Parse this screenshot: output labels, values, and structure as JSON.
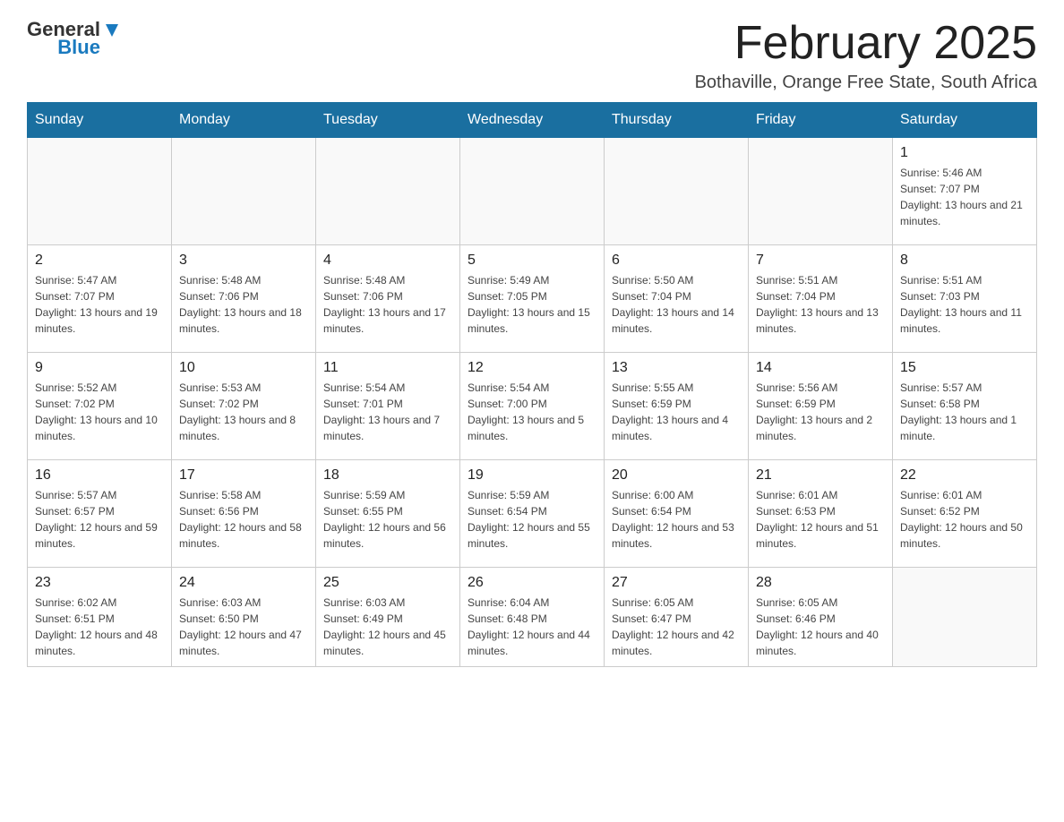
{
  "header": {
    "logo": {
      "general": "General",
      "blue": "Blue"
    },
    "month": "February 2025",
    "location": "Bothaville, Orange Free State, South Africa"
  },
  "days_of_week": [
    "Sunday",
    "Monday",
    "Tuesday",
    "Wednesday",
    "Thursday",
    "Friday",
    "Saturday"
  ],
  "weeks": [
    [
      {
        "day": "",
        "sunrise": "",
        "sunset": "",
        "daylight": "",
        "empty": true
      },
      {
        "day": "",
        "sunrise": "",
        "sunset": "",
        "daylight": "",
        "empty": true
      },
      {
        "day": "",
        "sunrise": "",
        "sunset": "",
        "daylight": "",
        "empty": true
      },
      {
        "day": "",
        "sunrise": "",
        "sunset": "",
        "daylight": "",
        "empty": true
      },
      {
        "day": "",
        "sunrise": "",
        "sunset": "",
        "daylight": "",
        "empty": true
      },
      {
        "day": "",
        "sunrise": "",
        "sunset": "",
        "daylight": "",
        "empty": true
      },
      {
        "day": "1",
        "sunrise": "Sunrise: 5:46 AM",
        "sunset": "Sunset: 7:07 PM",
        "daylight": "Daylight: 13 hours and 21 minutes.",
        "empty": false
      }
    ],
    [
      {
        "day": "2",
        "sunrise": "Sunrise: 5:47 AM",
        "sunset": "Sunset: 7:07 PM",
        "daylight": "Daylight: 13 hours and 19 minutes.",
        "empty": false
      },
      {
        "day": "3",
        "sunrise": "Sunrise: 5:48 AM",
        "sunset": "Sunset: 7:06 PM",
        "daylight": "Daylight: 13 hours and 18 minutes.",
        "empty": false
      },
      {
        "day": "4",
        "sunrise": "Sunrise: 5:48 AM",
        "sunset": "Sunset: 7:06 PM",
        "daylight": "Daylight: 13 hours and 17 minutes.",
        "empty": false
      },
      {
        "day": "5",
        "sunrise": "Sunrise: 5:49 AM",
        "sunset": "Sunset: 7:05 PM",
        "daylight": "Daylight: 13 hours and 15 minutes.",
        "empty": false
      },
      {
        "day": "6",
        "sunrise": "Sunrise: 5:50 AM",
        "sunset": "Sunset: 7:04 PM",
        "daylight": "Daylight: 13 hours and 14 minutes.",
        "empty": false
      },
      {
        "day": "7",
        "sunrise": "Sunrise: 5:51 AM",
        "sunset": "Sunset: 7:04 PM",
        "daylight": "Daylight: 13 hours and 13 minutes.",
        "empty": false
      },
      {
        "day": "8",
        "sunrise": "Sunrise: 5:51 AM",
        "sunset": "Sunset: 7:03 PM",
        "daylight": "Daylight: 13 hours and 11 minutes.",
        "empty": false
      }
    ],
    [
      {
        "day": "9",
        "sunrise": "Sunrise: 5:52 AM",
        "sunset": "Sunset: 7:02 PM",
        "daylight": "Daylight: 13 hours and 10 minutes.",
        "empty": false
      },
      {
        "day": "10",
        "sunrise": "Sunrise: 5:53 AM",
        "sunset": "Sunset: 7:02 PM",
        "daylight": "Daylight: 13 hours and 8 minutes.",
        "empty": false
      },
      {
        "day": "11",
        "sunrise": "Sunrise: 5:54 AM",
        "sunset": "Sunset: 7:01 PM",
        "daylight": "Daylight: 13 hours and 7 minutes.",
        "empty": false
      },
      {
        "day": "12",
        "sunrise": "Sunrise: 5:54 AM",
        "sunset": "Sunset: 7:00 PM",
        "daylight": "Daylight: 13 hours and 5 minutes.",
        "empty": false
      },
      {
        "day": "13",
        "sunrise": "Sunrise: 5:55 AM",
        "sunset": "Sunset: 6:59 PM",
        "daylight": "Daylight: 13 hours and 4 minutes.",
        "empty": false
      },
      {
        "day": "14",
        "sunrise": "Sunrise: 5:56 AM",
        "sunset": "Sunset: 6:59 PM",
        "daylight": "Daylight: 13 hours and 2 minutes.",
        "empty": false
      },
      {
        "day": "15",
        "sunrise": "Sunrise: 5:57 AM",
        "sunset": "Sunset: 6:58 PM",
        "daylight": "Daylight: 13 hours and 1 minute.",
        "empty": false
      }
    ],
    [
      {
        "day": "16",
        "sunrise": "Sunrise: 5:57 AM",
        "sunset": "Sunset: 6:57 PM",
        "daylight": "Daylight: 12 hours and 59 minutes.",
        "empty": false
      },
      {
        "day": "17",
        "sunrise": "Sunrise: 5:58 AM",
        "sunset": "Sunset: 6:56 PM",
        "daylight": "Daylight: 12 hours and 58 minutes.",
        "empty": false
      },
      {
        "day": "18",
        "sunrise": "Sunrise: 5:59 AM",
        "sunset": "Sunset: 6:55 PM",
        "daylight": "Daylight: 12 hours and 56 minutes.",
        "empty": false
      },
      {
        "day": "19",
        "sunrise": "Sunrise: 5:59 AM",
        "sunset": "Sunset: 6:54 PM",
        "daylight": "Daylight: 12 hours and 55 minutes.",
        "empty": false
      },
      {
        "day": "20",
        "sunrise": "Sunrise: 6:00 AM",
        "sunset": "Sunset: 6:54 PM",
        "daylight": "Daylight: 12 hours and 53 minutes.",
        "empty": false
      },
      {
        "day": "21",
        "sunrise": "Sunrise: 6:01 AM",
        "sunset": "Sunset: 6:53 PM",
        "daylight": "Daylight: 12 hours and 51 minutes.",
        "empty": false
      },
      {
        "day": "22",
        "sunrise": "Sunrise: 6:01 AM",
        "sunset": "Sunset: 6:52 PM",
        "daylight": "Daylight: 12 hours and 50 minutes.",
        "empty": false
      }
    ],
    [
      {
        "day": "23",
        "sunrise": "Sunrise: 6:02 AM",
        "sunset": "Sunset: 6:51 PM",
        "daylight": "Daylight: 12 hours and 48 minutes.",
        "empty": false
      },
      {
        "day": "24",
        "sunrise": "Sunrise: 6:03 AM",
        "sunset": "Sunset: 6:50 PM",
        "daylight": "Daylight: 12 hours and 47 minutes.",
        "empty": false
      },
      {
        "day": "25",
        "sunrise": "Sunrise: 6:03 AM",
        "sunset": "Sunset: 6:49 PM",
        "daylight": "Daylight: 12 hours and 45 minutes.",
        "empty": false
      },
      {
        "day": "26",
        "sunrise": "Sunrise: 6:04 AM",
        "sunset": "Sunset: 6:48 PM",
        "daylight": "Daylight: 12 hours and 44 minutes.",
        "empty": false
      },
      {
        "day": "27",
        "sunrise": "Sunrise: 6:05 AM",
        "sunset": "Sunset: 6:47 PM",
        "daylight": "Daylight: 12 hours and 42 minutes.",
        "empty": false
      },
      {
        "day": "28",
        "sunrise": "Sunrise: 6:05 AM",
        "sunset": "Sunset: 6:46 PM",
        "daylight": "Daylight: 12 hours and 40 minutes.",
        "empty": false
      },
      {
        "day": "",
        "sunrise": "",
        "sunset": "",
        "daylight": "",
        "empty": true
      }
    ]
  ]
}
